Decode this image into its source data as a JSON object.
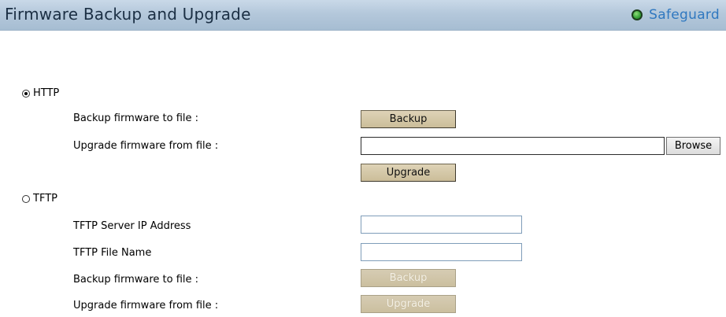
{
  "header": {
    "title": "Firmware Backup and Upgrade",
    "safeguard_label": "Safeguard",
    "safeguard_color": "#3aa63a"
  },
  "http": {
    "label": "HTTP",
    "selected": true,
    "backup_label": "Backup firmware to file :",
    "backup_button": "Backup",
    "upgrade_label": "Upgrade firmware from file :",
    "file_value": "",
    "browse_button": "Browse",
    "upgrade_button": "Upgrade"
  },
  "tftp": {
    "label": "TFTP",
    "selected": false,
    "server_ip_label": "TFTP Server IP Address",
    "server_ip_value": "",
    "file_name_label": "TFTP File Name",
    "file_name_value": "",
    "backup_label": "Backup firmware to file :",
    "backup_button": "Backup",
    "upgrade_label": "Upgrade firmware from file :",
    "upgrade_button": "Upgrade"
  }
}
